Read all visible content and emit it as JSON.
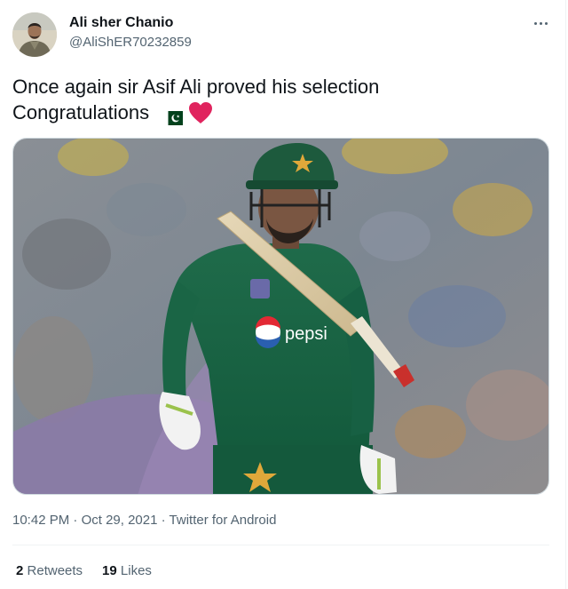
{
  "author": {
    "display_name": "Ali sher Chanio",
    "handle": "@AliShER70232859"
  },
  "tweet": {
    "line1": "Once again sir Asif Ali proved his selection",
    "line2": "Congratulations"
  },
  "media": {
    "jersey_text": "pepsi"
  },
  "meta": {
    "time": "10:42 PM",
    "sep1": " · ",
    "date": "Oct 29, 2021",
    "sep2": " · ",
    "source": "Twitter for Android"
  },
  "stats": {
    "retweets_count": "2",
    "retweets_label": "Retweets",
    "likes_count": "19",
    "likes_label": "Likes"
  },
  "icons": {
    "more": "more-icon",
    "flag": "pakistan-flag-icon",
    "heart": "red-heart-icon"
  },
  "colors": {
    "text_primary": "#0f1419",
    "text_secondary": "#536471",
    "heart": "#e0245e",
    "flag_green": "#01411c"
  }
}
